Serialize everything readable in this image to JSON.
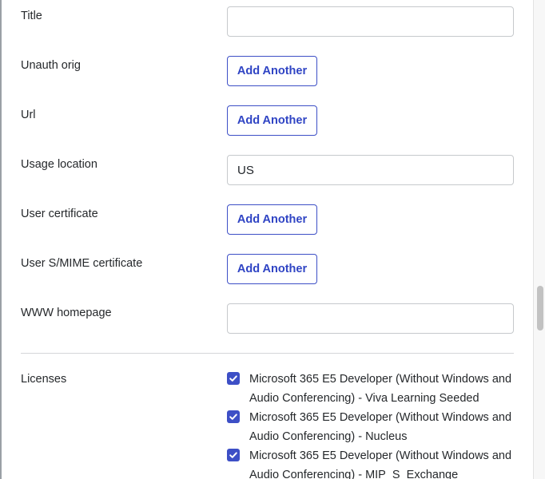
{
  "fields": [
    {
      "label": "Title",
      "type": "input",
      "value": ""
    },
    {
      "label": "Unauth orig",
      "type": "button",
      "button_label": "Add Another"
    },
    {
      "label": "Url",
      "type": "button",
      "button_label": "Add Another"
    },
    {
      "label": "Usage location",
      "type": "input",
      "value": "US"
    },
    {
      "label": "User certificate",
      "type": "button",
      "button_label": "Add Another"
    },
    {
      "label": "User S/MIME certificate",
      "type": "button",
      "button_label": "Add Another"
    },
    {
      "label": "WWW homepage",
      "type": "input",
      "value": ""
    }
  ],
  "licenses": {
    "label": "Licenses",
    "items": [
      {
        "name": "Microsoft 365 E5 Developer (Without Windows and Audio Conferencing) - Viva Learning Seeded",
        "checked": true
      },
      {
        "name": "Microsoft 365 E5 Developer (Without Windows and Audio Conferencing) - Nucleus",
        "checked": true
      },
      {
        "name": "Microsoft 365 E5 Developer (Without Windows and Audio Conferencing) - MIP_S_Exchange",
        "checked": true
      }
    ]
  },
  "colors": {
    "accent": "#3d4fc6",
    "border": "#c6c9cc",
    "divider": "#d4d6d9"
  },
  "icons": {
    "checkbox": "check-icon"
  }
}
